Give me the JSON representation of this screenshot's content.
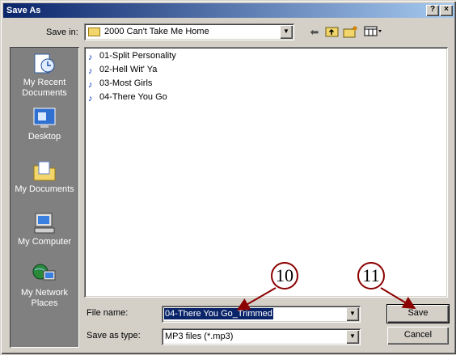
{
  "title": "Save As",
  "title_buttons": {
    "help": "?",
    "close": "×"
  },
  "save_in": {
    "label": "Save in:",
    "value": "2000 Can't Take Me Home"
  },
  "places": [
    "My Recent Documents",
    "Desktop",
    "My Documents",
    "My Computer",
    "My Network Places"
  ],
  "files": [
    "01-Split Personality",
    "02-Hell Wit' Ya",
    "03-Most Girls",
    "04-There You Go"
  ],
  "file_name": {
    "label": "File name:",
    "value": "04-There You Go_Trimmed"
  },
  "save_as_type": {
    "label": "Save as type:",
    "value": "MP3 files (*.mp3)"
  },
  "buttons": {
    "save": "Save",
    "cancel": "Cancel"
  },
  "callouts": {
    "file_name": "10",
    "save": "11"
  },
  "colors": {
    "callout_arrow": "#8b0000",
    "title_gradient_start": "#0a246a",
    "title_gradient_end": "#a6caf0",
    "selection": "#0a246a"
  }
}
